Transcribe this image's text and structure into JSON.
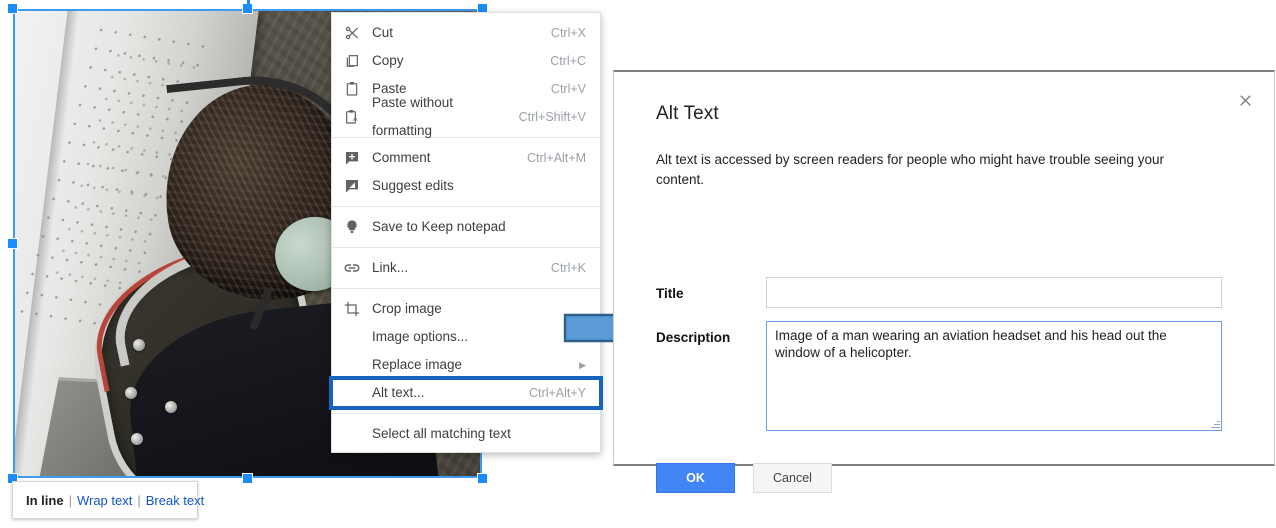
{
  "document_image": {
    "alt_summary": "Photo of a man wearing an aviation headset leaning his head out the window of a helicopter",
    "selected": true,
    "wrap_bar": {
      "current_label": "In line",
      "separator": "|",
      "options": [
        "Wrap text",
        "Break text"
      ]
    }
  },
  "context_menu": {
    "groups": [
      {
        "items": [
          {
            "label": "Cut",
            "accel": "Ctrl+X",
            "icon": "scissors-icon"
          },
          {
            "label": "Copy",
            "accel": "Ctrl+C",
            "icon": "copy-icon"
          },
          {
            "label": "Paste",
            "accel": "Ctrl+V",
            "icon": "clipboard-icon"
          },
          {
            "label": "Paste without formatting",
            "accel": "Ctrl+Shift+V",
            "icon": "clipboard-text-icon"
          }
        ]
      },
      {
        "items": [
          {
            "label": "Comment",
            "accel": "Ctrl+Alt+M",
            "icon": "comment-plus-icon"
          },
          {
            "label": "Suggest edits",
            "accel": "",
            "icon": "suggest-edits-icon"
          }
        ]
      },
      {
        "items": [
          {
            "label": "Save to Keep notepad",
            "accel": "",
            "icon": "keep-bulb-icon"
          }
        ]
      },
      {
        "items": [
          {
            "label": "Link...",
            "accel": "Ctrl+K",
            "icon": "link-icon"
          }
        ]
      },
      {
        "items": [
          {
            "label": "Crop image",
            "accel": "",
            "icon": "crop-icon"
          },
          {
            "label": "Image options...",
            "accel": "",
            "icon": "none"
          },
          {
            "label": "Replace image",
            "accel": "",
            "icon": "none",
            "submenu": true
          },
          {
            "label": "Alt text...",
            "accel": "Ctrl+Alt+Y",
            "icon": "none",
            "highlighted": true
          }
        ]
      },
      {
        "items": [
          {
            "label": "Select all matching text",
            "accel": "",
            "icon": "none"
          }
        ]
      }
    ]
  },
  "annotation": {
    "arrow": "right-arrow-callout",
    "arrow_color": "#5b9bd5",
    "arrow_border_color": "#2e5f8a"
  },
  "alt_dialog": {
    "title": "Alt Text",
    "description_text": "Alt text is accessed by screen readers for people who might have trouble seeing your content.",
    "close_icon": "close-icon",
    "fields": {
      "title": {
        "label": "Title",
        "value": "",
        "placeholder": ""
      },
      "description": {
        "label": "Description",
        "value": "Image of a man wearing an aviation headset and his head out the window of a helicopter.",
        "placeholder": "",
        "focused": true
      }
    },
    "buttons": {
      "ok": "OK",
      "cancel": "Cancel"
    },
    "accent_color": "#4285f4",
    "highlight_color": "#1565c0"
  }
}
